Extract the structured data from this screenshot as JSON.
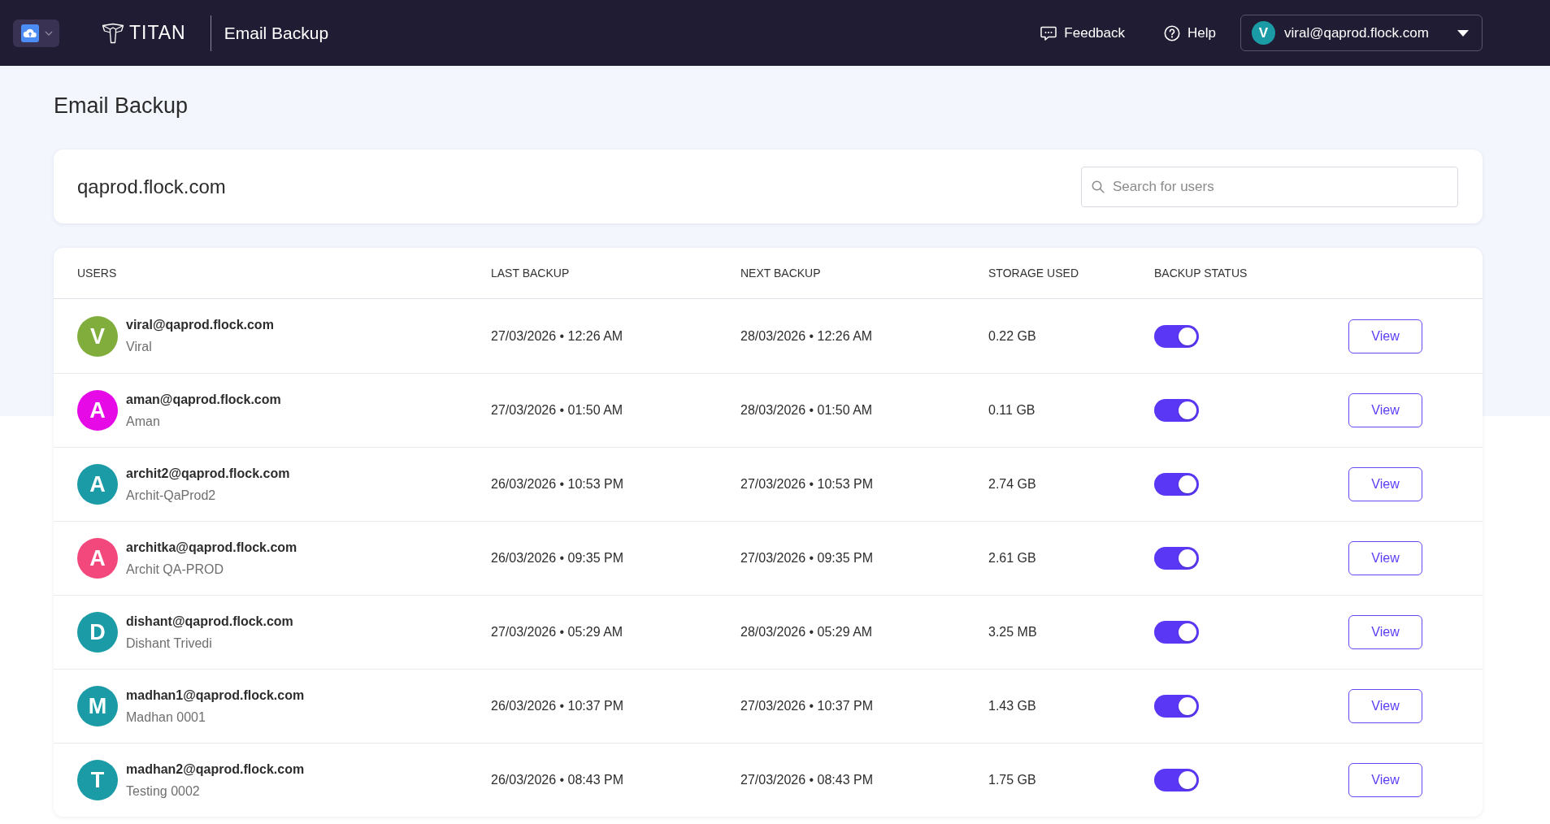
{
  "app_bar": {
    "logo_text": "TITAN",
    "title": "Email Backup",
    "links": [
      {
        "kind": "feedback",
        "label": "Feedback"
      },
      {
        "kind": "help",
        "label": "Help"
      }
    ],
    "account": {
      "initial": "V",
      "email": "viral@qaprod.flock.com"
    }
  },
  "page": {
    "title": "Email Backup"
  },
  "domain_card": {
    "domain": "qaprod.flock.com",
    "search": {
      "placeholder": "Search for users"
    }
  },
  "table": {
    "columns": [
      "USERS",
      "LAST BACKUP",
      "NEXT BACKUP",
      "STORAGE USED",
      "BACKUP STATUS"
    ],
    "rows": [
      {
        "initial": "V",
        "color": "#80ad3c",
        "email": "viral@qaprod.flock.com",
        "name": "Viral",
        "last_backup": "27/03/2026 • 12:26 AM",
        "next_backup": "28/03/2026 • 12:26 AM",
        "storage_used": "0.22 GB",
        "on": true,
        "action": "View"
      },
      {
        "initial": "A",
        "color": "#e60be6",
        "email": "aman@qaprod.flock.com",
        "name": "Aman",
        "last_backup": "27/03/2026 • 01:50 AM",
        "next_backup": "28/03/2026 • 01:50 AM",
        "storage_used": "0.11 GB",
        "on": true,
        "action": "View"
      },
      {
        "initial": "A",
        "color": "#1b9ba6",
        "email": "archit2@qaprod.flock.com",
        "name": "Archit-QaProd2",
        "last_backup": "26/03/2026 • 10:53 PM",
        "next_backup": "27/03/2026 • 10:53 PM",
        "storage_used": "2.74 GB",
        "on": true,
        "action": "View"
      },
      {
        "initial": "A",
        "color": "#f2487c",
        "email": "architka@qaprod.flock.com",
        "name": "Archit QA-PROD",
        "last_backup": "26/03/2026 • 09:35 PM",
        "next_backup": "27/03/2026 • 09:35 PM",
        "storage_used": "2.61 GB",
        "on": true,
        "action": "View"
      },
      {
        "initial": "D",
        "color": "#1b9ba6",
        "email": "dishant@qaprod.flock.com",
        "name": "Dishant Trivedi",
        "last_backup": "27/03/2026 • 05:29 AM",
        "next_backup": "28/03/2026 • 05:29 AM",
        "storage_used": "3.25 MB",
        "on": true,
        "action": "View"
      },
      {
        "initial": "M",
        "color": "#1b9ba6",
        "email": "madhan1@qaprod.flock.com",
        "name": "Madhan 0001",
        "last_backup": "26/03/2026 • 10:37 PM",
        "next_backup": "27/03/2026 • 10:37 PM",
        "storage_used": "1.43 GB",
        "on": true,
        "action": "View"
      },
      {
        "initial": "T",
        "color": "#1b9ba6",
        "email": "madhan2@qaprod.flock.com",
        "name": "Testing 0002",
        "last_backup": "26/03/2026 • 08:43 PM",
        "next_backup": "27/03/2026 • 08:43 PM",
        "storage_used": "1.75 GB",
        "on": true,
        "action": "View"
      }
    ]
  }
}
